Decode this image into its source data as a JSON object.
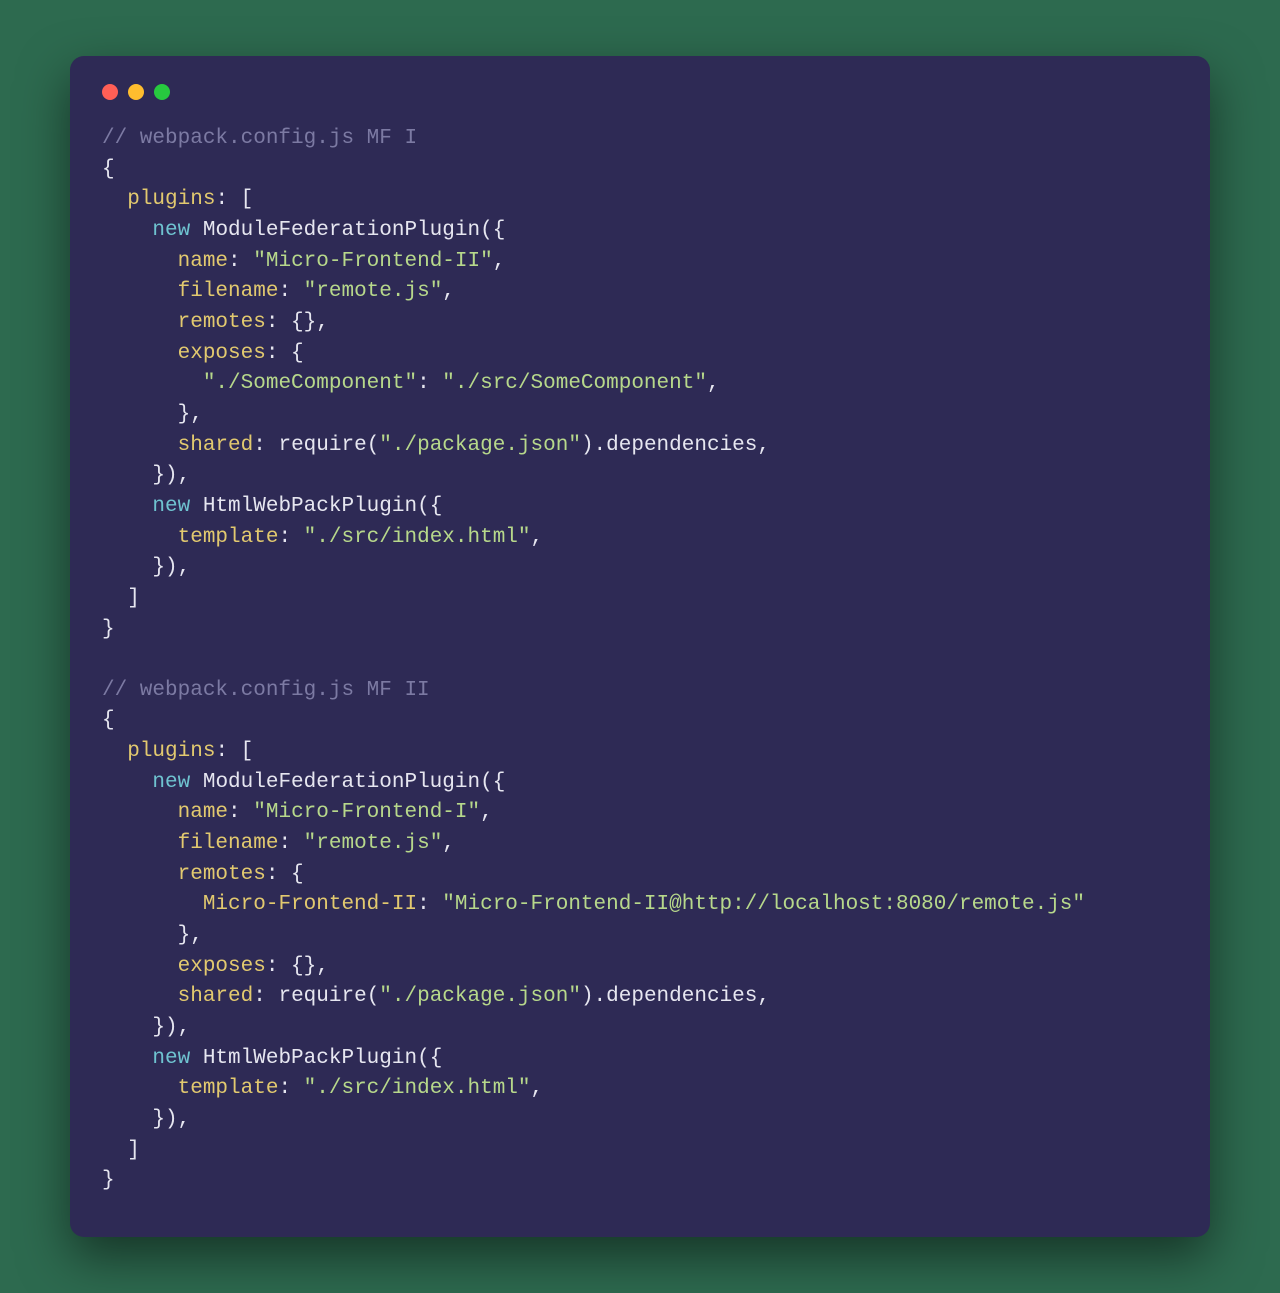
{
  "colors": {
    "bg_page": "#2d6a4f",
    "bg_window": "#2e2a55",
    "dot_red": "#ff5f56",
    "dot_yellow": "#ffbd2e",
    "dot_green": "#27c93f",
    "comment": "#7c7aa3",
    "key": "#e2c96f",
    "keyword": "#6fc3d0",
    "string": "#b7d88b",
    "text": "#e6e6f0"
  },
  "mf1": {
    "comment": "// webpack.config.js MF I",
    "plugins_key": "plugins",
    "new_kw_1": "new",
    "mfp_ident": "ModuleFederationPlugin",
    "name_key": "name",
    "name_val": "\"Micro-Frontend-II\"",
    "filename_key": "filename",
    "filename_val": "\"remote.js\"",
    "remotes_key": "remotes",
    "exposes_key": "exposes",
    "expose_item_key": "\"./SomeComponent\"",
    "expose_item_val": "\"./src/SomeComponent\"",
    "shared_key": "shared",
    "require_fn": "require",
    "require_arg": "\"./package.json\"",
    "deps_ident": ".dependencies",
    "new_kw_2": "new",
    "hwp_ident": "HtmlWebPackPlugin",
    "template_key": "template",
    "template_val": "\"./src/index.html\""
  },
  "mf2": {
    "comment": "// webpack.config.js MF II",
    "plugins_key": "plugins",
    "new_kw_1": "new",
    "mfp_ident": "ModuleFederationPlugin",
    "name_key": "name",
    "name_val": "\"Micro-Frontend-I\"",
    "filename_key": "filename",
    "filename_val": "\"remote.js\"",
    "remotes_key": "remotes",
    "remote_entry_key": "Micro-Frontend-II",
    "remote_entry_val": "\"Micro-Frontend-II@http://localhost:8080/remote.js\"",
    "exposes_key": "exposes",
    "shared_key": "shared",
    "require_fn": "require",
    "require_arg": "\"./package.json\"",
    "deps_ident": ".dependencies",
    "new_kw_2": "new",
    "hwp_ident": "HtmlWebPackPlugin",
    "template_key": "template",
    "template_val": "\"./src/index.html\""
  }
}
